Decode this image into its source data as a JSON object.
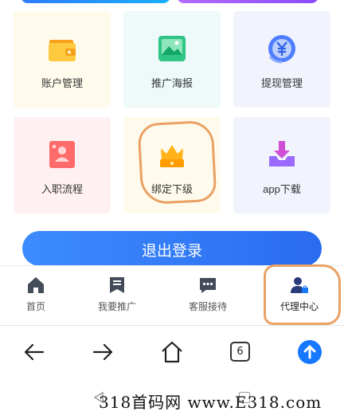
{
  "grid": {
    "row1": [
      {
        "label": "账户管理",
        "icon": "wallet-icon"
      },
      {
        "label": "推广海报",
        "icon": "image-icon"
      },
      {
        "label": "提现管理",
        "icon": "yuan-exchange-icon"
      }
    ],
    "row2": [
      {
        "label": "入职流程",
        "icon": "id-card-icon"
      },
      {
        "label": "绑定下级",
        "icon": "crown-bag-icon"
      },
      {
        "label": "app下载",
        "icon": "download-tray-icon"
      }
    ]
  },
  "logout": {
    "label": "退出登录"
  },
  "app_nav": [
    {
      "label": "首页",
      "icon": "home-icon"
    },
    {
      "label": "我要推广",
      "icon": "promote-doc-icon"
    },
    {
      "label": "客服接待",
      "icon": "chat-icon"
    },
    {
      "label": "代理中心",
      "icon": "agent-user-icon",
      "active": true
    }
  ],
  "browser": {
    "tab_count": "6"
  },
  "watermark": {
    "text": "318首码网 www.E318.com"
  },
  "colors": {
    "accent": "#2a6cf0",
    "highlight": "#e9a165"
  }
}
